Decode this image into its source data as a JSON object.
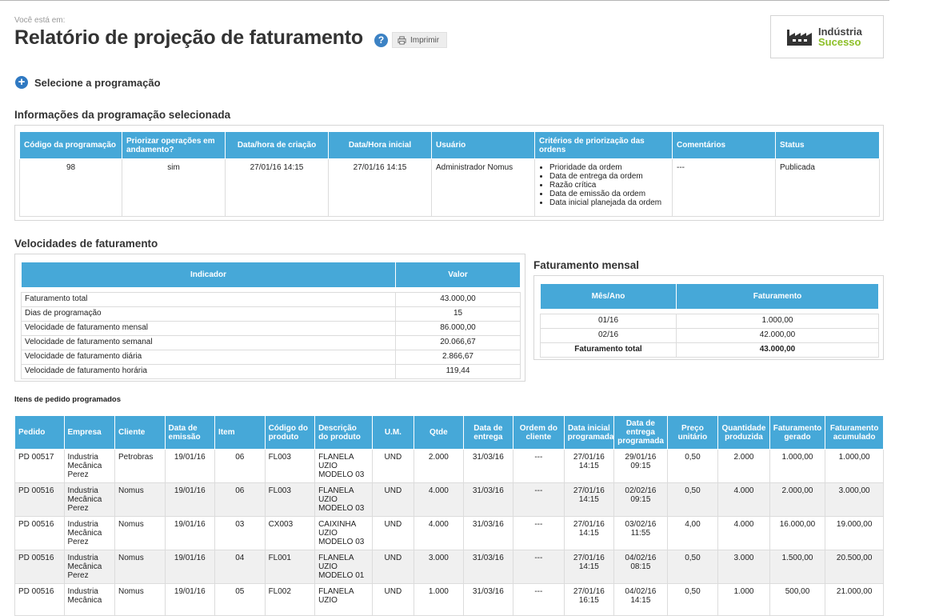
{
  "header": {
    "breadcrumb": "Você está em:",
    "title": "Relatório de projeção de faturamento",
    "help_label": "?",
    "print_label": "Imprimir",
    "logo_line1": "Indústria",
    "logo_line2": "Sucesso"
  },
  "select_programming": {
    "icon": "+",
    "label": "Selecione a programação"
  },
  "info": {
    "title": "Informações da programação selecionada",
    "headers": [
      "Código da programação",
      "Priorizar operações em andamento?",
      "Data/hora de criação",
      "Data/Hora inicial",
      "Usuário",
      "Critérios de priorização das ordens",
      "Comentários",
      "Status"
    ],
    "row": {
      "code": "98",
      "prioritize": "sim",
      "created": "27/01/16 14:15",
      "start": "27/01/16 14:15",
      "user": "Administrador Nomus",
      "criteria": [
        "Prioridade da ordem",
        "Data de entrega da ordem",
        "Razão crítica",
        "Data de emissão da ordem",
        "Data inicial planejada da ordem"
      ],
      "comments": "---",
      "status": "Publicada"
    }
  },
  "velocidades": {
    "title": "Velocidades de faturamento",
    "headers": [
      "Indicador",
      "Valor"
    ],
    "rows": [
      [
        "Faturamento total",
        "43.000,00"
      ],
      [
        "Dias de programação",
        "15"
      ],
      [
        "Velocidade de faturamento mensal",
        "86.000,00"
      ],
      [
        "Velocidade de faturamento semanal",
        "20.066,67"
      ],
      [
        "Velocidade de faturamento diária",
        "2.866,67"
      ],
      [
        "Velocidade de faturamento horária",
        "119,44"
      ]
    ]
  },
  "mensal": {
    "title": "Faturamento mensal",
    "headers": [
      "Mês/Ano",
      "Faturamento"
    ],
    "rows": [
      [
        "01/16",
        "1.000,00"
      ],
      [
        "02/16",
        "42.000,00"
      ]
    ],
    "total": [
      "Faturamento total",
      "43.000,00"
    ]
  },
  "items": {
    "title": "Itens de pedido programados",
    "headers": [
      "Pedido",
      "Empresa",
      "Cliente",
      "Data de emissão",
      "Item",
      "Código do produto",
      "Descrição do produto",
      "U.M.",
      "Qtde",
      "Data de entrega",
      "Ordem do cliente",
      "Data inicial programada",
      "Data de entrega programada",
      "Preço unitário",
      "Quantidade produzida",
      "Faturamento gerado",
      "Faturamento acumulado"
    ],
    "rows": [
      [
        "PD 00517",
        "Industria Mecânica Perez",
        "Petrobras",
        "19/01/16",
        "06",
        "FL003",
        "FLANELA UZIO MODELO 03",
        "UND",
        "2.000",
        "31/03/16",
        "---",
        "27/01/16 14:15",
        "29/01/16 09:15",
        "0,50",
        "2.000",
        "1.000,00",
        "1.000,00"
      ],
      [
        "PD 00516",
        "Industria Mecânica Perez",
        "Nomus",
        "19/01/16",
        "06",
        "FL003",
        "FLANELA UZIO MODELO 03",
        "UND",
        "4.000",
        "31/03/16",
        "---",
        "27/01/16 14:15",
        "02/02/16 09:15",
        "0,50",
        "4.000",
        "2.000,00",
        "3.000,00"
      ],
      [
        "PD 00516",
        "Industria Mecânica Perez",
        "Nomus",
        "19/01/16",
        "03",
        "CX003",
        "CAIXINHA UZIO MODELO 03",
        "UND",
        "4.000",
        "31/03/16",
        "---",
        "27/01/16 14:15",
        "03/02/16 11:55",
        "4,00",
        "4.000",
        "16.000,00",
        "19.000,00"
      ],
      [
        "PD 00516",
        "Industria Mecânica Perez",
        "Nomus",
        "19/01/16",
        "04",
        "FL001",
        "FLANELA UZIO MODELO 01",
        "UND",
        "3.000",
        "31/03/16",
        "---",
        "27/01/16 14:15",
        "04/02/16 08:15",
        "0,50",
        "3.000",
        "1.500,00",
        "20.500,00"
      ],
      [
        "PD 00516",
        "Industria Mecânica",
        "Nomus",
        "19/01/16",
        "05",
        "FL002",
        "FLANELA UZIO",
        "UND",
        "1.000",
        "31/03/16",
        "---",
        "27/01/16 16:15",
        "04/02/16 14:15",
        "0,50",
        "1.000",
        "500,00",
        "21.000,00"
      ]
    ]
  },
  "colors": {
    "accent": "#46a8d8",
    "button_blue": "#2f79c2",
    "logo_green": "#8cbf26"
  }
}
